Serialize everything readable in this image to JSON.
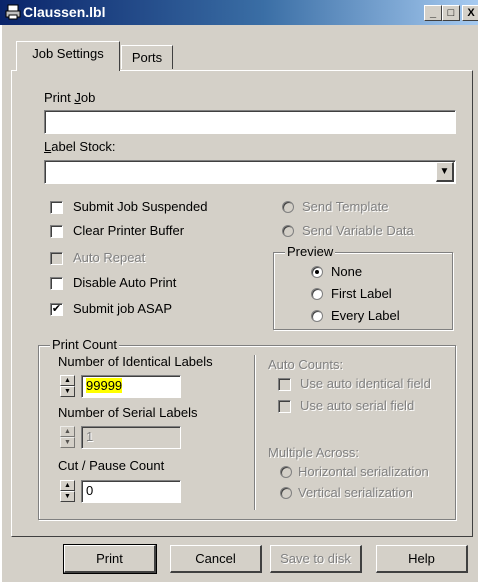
{
  "window": {
    "title": "Claussen.lbl",
    "minimize_glyph": "_",
    "maximize_glyph": "□",
    "close_glyph": "X"
  },
  "tabs": [
    "Job Settings",
    "Ports"
  ],
  "print_job": {
    "label": "Print Job",
    "value": ""
  },
  "label_stock": {
    "label": "Label Stock:",
    "value": ""
  },
  "options": {
    "submit_suspended": {
      "label": "Submit Job Suspended",
      "checked": false
    },
    "clear_buffer": {
      "label": "Clear Printer Buffer",
      "checked": false
    },
    "auto_repeat": {
      "label": "Auto Repeat",
      "checked": false,
      "disabled": true
    },
    "disable_auto_print": {
      "label": "Disable Auto Print",
      "checked": false
    },
    "submit_asap": {
      "label": "Submit job ASAP",
      "checked": true
    }
  },
  "send": {
    "template": "Send Template",
    "variable": "Send Variable Data"
  },
  "preview": {
    "title": "Preview",
    "none": "None",
    "first": "First Label",
    "every": "Every Label",
    "selected": "None"
  },
  "print_count": {
    "title": "Print Count",
    "identical_label": "Number of Identical Labels",
    "identical_value": "99999",
    "serial_label": "Number of Serial Labels",
    "serial_value": "1",
    "cut_label": "Cut / Pause Count",
    "cut_value": "0"
  },
  "auto_counts": {
    "title": "Auto Counts:",
    "identical": "Use auto identical field",
    "serial": "Use auto serial field"
  },
  "multiple_across": {
    "title": "Multiple Across:",
    "horizontal": "Horizontal serialization",
    "vertical": "Vertical serialization"
  },
  "buttons": {
    "print": "Print",
    "cancel": "Cancel",
    "save": "Save to disk",
    "help": "Help"
  },
  "colors": {
    "titlebar_start": "#0a246a",
    "titlebar_end": "#a6caf0",
    "face": "#d4d0c8",
    "highlight": "#ffff00"
  },
  "icons": {
    "app": "printer-icon",
    "dropdown": "chevron-down-icon",
    "spin": "spin-arrows-icon"
  }
}
